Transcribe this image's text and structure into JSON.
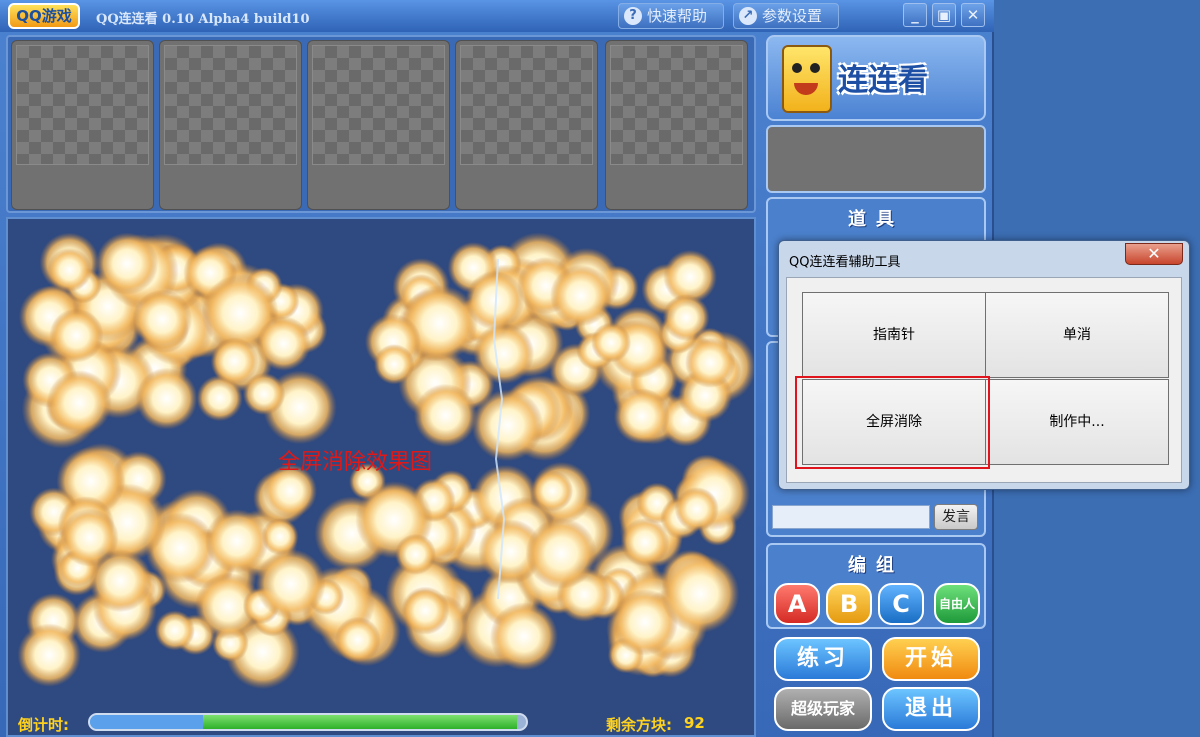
{
  "titlebar": {
    "logo_text": "QQ游戏",
    "app_title": "QQ连连看 0.10 Alpha4 build10",
    "help_label": "快速帮助",
    "settings_label": "参数设置",
    "minimize": "_",
    "maximize": "▣",
    "close": "✕"
  },
  "brand": {
    "text": "连连看"
  },
  "props": {
    "title": "道具"
  },
  "chat": {
    "send_label": "发言",
    "input_value": ""
  },
  "group": {
    "title": "编组",
    "buttons": [
      "A",
      "B",
      "C",
      "自由人"
    ]
  },
  "actions": {
    "practice": "练习",
    "start": "开始",
    "super_player": "超级玩家",
    "exit": "退出"
  },
  "board": {
    "caption": "全屏消除效果图",
    "timer_label": "倒计时:",
    "timer_progress": {
      "blue": 0.26,
      "green": 0.98
    },
    "remain_label": "剩余方块:",
    "remain_count": "92"
  },
  "dialog": {
    "title": "QQ连连看辅助工具",
    "close": "✕",
    "buttons": [
      "指南针",
      "单消",
      "全屏消除",
      "制作中..."
    ]
  },
  "colors": {
    "accent_red": "#e01818",
    "group_a": "#e8403a",
    "group_b": "#f4b21c",
    "group_c": "#2a8ad8",
    "group_free": "#2fb04a"
  }
}
